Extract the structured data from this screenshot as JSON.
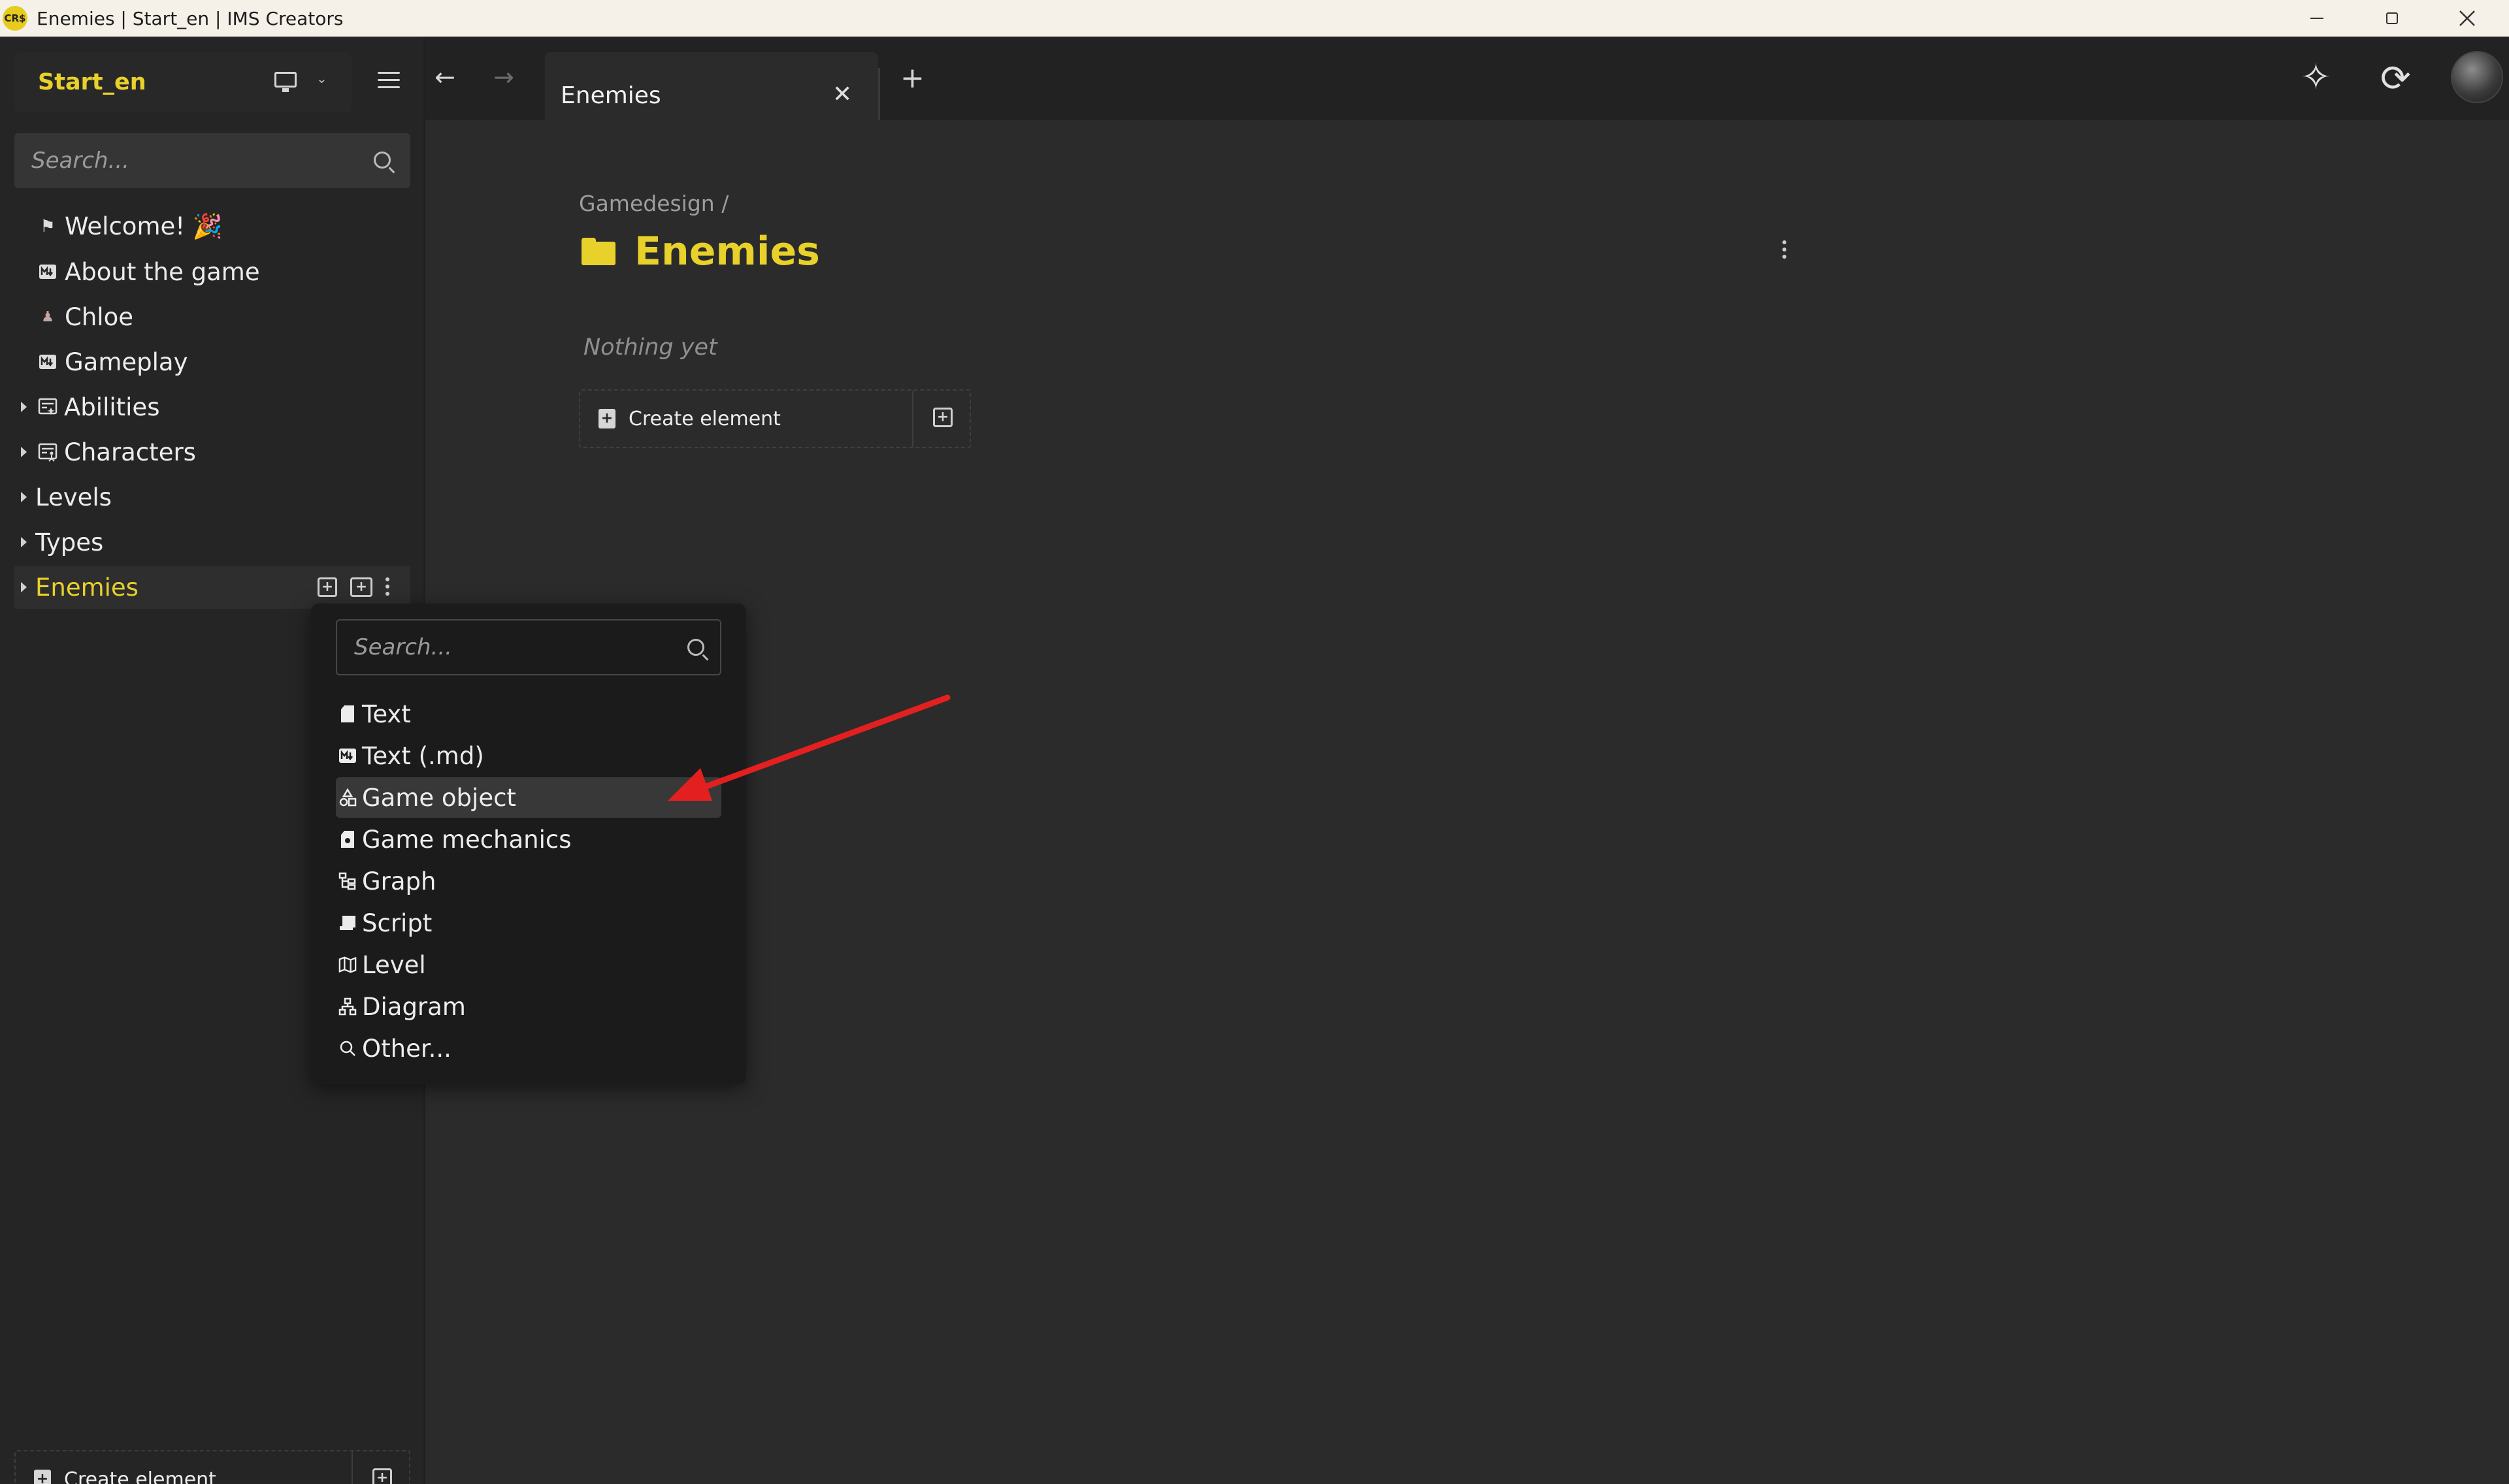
{
  "window": {
    "logo_text": "CR$",
    "title": "Enemies | Start_en | IMS Creators"
  },
  "sidebar": {
    "project_name": "Start_en",
    "search_placeholder": "Search...",
    "items": [
      {
        "label": "Welcome! 🎉",
        "icon": "flag-icon"
      },
      {
        "label": "About the game",
        "icon": "markdown-icon"
      },
      {
        "label": "Chloe",
        "icon": "character-icon"
      },
      {
        "label": "Gameplay",
        "icon": "markdown-icon"
      },
      {
        "label": "Abilities",
        "icon": "game-mechanics-folder-icon"
      },
      {
        "label": "Characters",
        "icon": "character-folder-icon"
      },
      {
        "label": "Levels",
        "icon": ""
      },
      {
        "label": "Types",
        "icon": ""
      },
      {
        "label": "Enemies",
        "icon": "",
        "active": true
      }
    ],
    "create_label": "Create element"
  },
  "tabs": {
    "active_tab": "Enemies"
  },
  "main": {
    "breadcrumb": "Gamedesign /",
    "title": "Enemies",
    "empty_text": "Nothing yet",
    "create_label": "Create element"
  },
  "menu": {
    "search_placeholder": "Search...",
    "items": [
      {
        "label": "Text",
        "icon": "document-icon"
      },
      {
        "label": "Text (.md)",
        "icon": "markdown-icon"
      },
      {
        "label": "Game object",
        "icon": "shapes-icon",
        "highlighted": true
      },
      {
        "label": "Game mechanics",
        "icon": "gear-document-icon"
      },
      {
        "label": "Graph",
        "icon": "graph-tree-icon"
      },
      {
        "label": "Script",
        "icon": "script-icon"
      },
      {
        "label": "Level",
        "icon": "map-icon"
      },
      {
        "label": "Diagram",
        "icon": "diagram-icon"
      },
      {
        "label": "Other...",
        "icon": "search-icon"
      }
    ]
  },
  "colors": {
    "accent": "#e8d12a",
    "annotation_arrow": "#e3201f"
  }
}
